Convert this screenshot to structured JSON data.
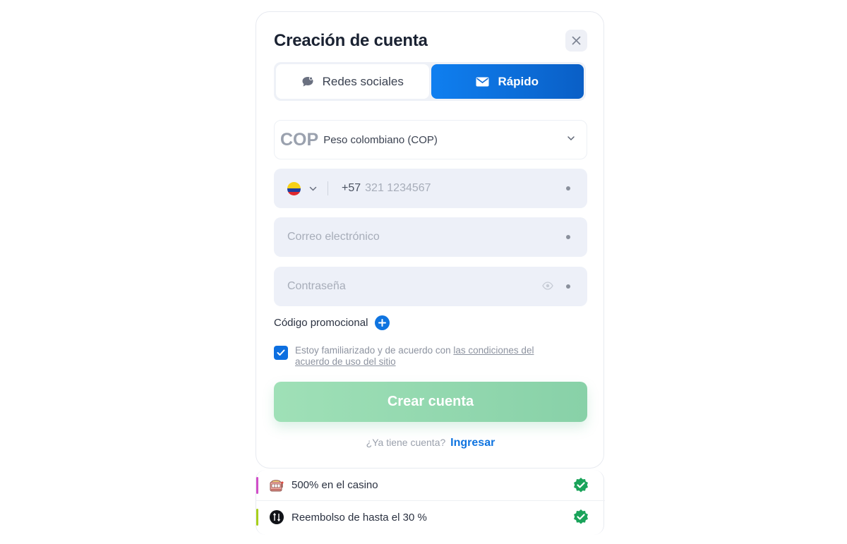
{
  "modal": {
    "title": "Creación de cuenta"
  },
  "tabs": [
    {
      "label": "Redes sociales",
      "icon": "chat-bubble-icon",
      "active": false
    },
    {
      "label": "Rápido",
      "icon": "envelope-icon",
      "active": true
    }
  ],
  "currency": {
    "code": "COP",
    "name": "Peso colombiano (COP)"
  },
  "phone": {
    "country_flag": "colombia-flag",
    "prefix": "+57",
    "placeholder": "321 1234567"
  },
  "email": {
    "placeholder": "Correo electrónico"
  },
  "password": {
    "placeholder": "Contraseña"
  },
  "promo": {
    "label": "Código promocional"
  },
  "agreement": {
    "checked": true,
    "text": "Estoy familiarizado y de acuerdo con ",
    "link": "las condiciones del acuerdo de uso del sitio"
  },
  "create_button": {
    "label": "Crear cuenta"
  },
  "login": {
    "question": "¿Ya tiene cuenta?",
    "link": "Ingresar"
  },
  "bonuses": [
    {
      "icon": "slot-machine-icon",
      "text": "500% en el casino",
      "accent": "#d14ec8"
    },
    {
      "icon": "cashback-coin-icon",
      "text": "Reembolso de hasta el 30 %",
      "accent": "#a8cf1c"
    }
  ],
  "colors": {
    "primary": "#0f74e0",
    "success_button": "#9fe0b7",
    "check_badge": "#1aa35a"
  }
}
